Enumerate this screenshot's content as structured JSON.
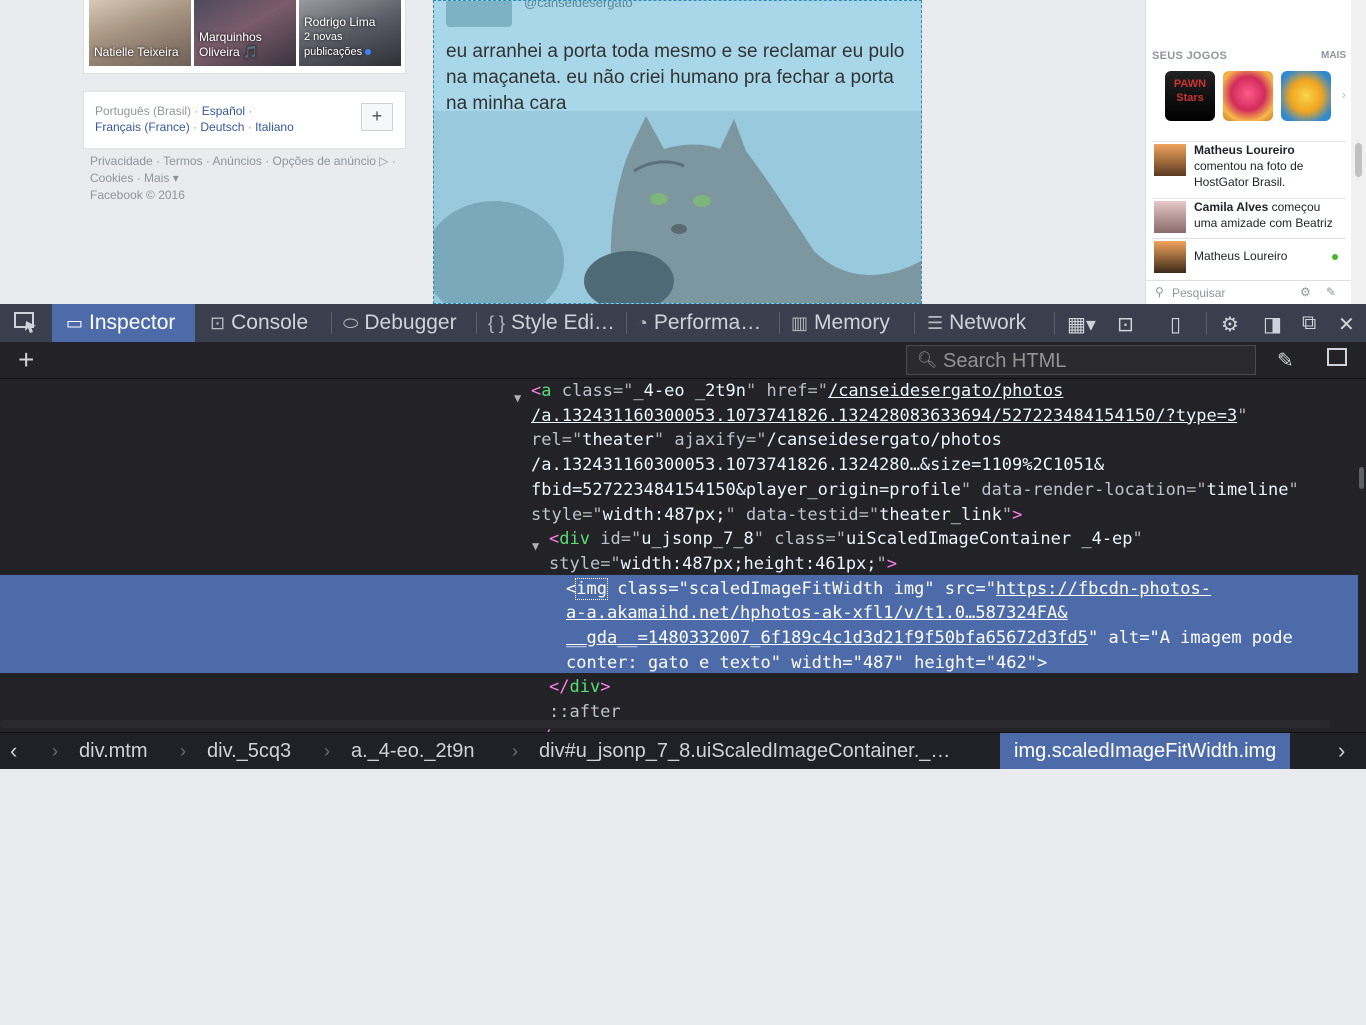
{
  "fb": {
    "friends": [
      {
        "name": "Natielle Teixeira",
        "sub": ""
      },
      {
        "name": "Marquinhos Oliveira 🎵",
        "sub": ""
      },
      {
        "name": "Rodrigo Lima",
        "sub": "2 novas publicações"
      }
    ],
    "languages": {
      "current": "Português (Brasil)",
      "links": [
        "Español",
        "Français (France)",
        "Deutsch",
        "Italiano"
      ],
      "add_label": "+"
    },
    "footer": {
      "line1": "Privacidade · Termos · Anúncios · Opções de anúncio ▷ ·",
      "line2": "Cookies · Mais ▾",
      "line3": "Facebook © 2016"
    },
    "post": {
      "handle": "@canseidesergato",
      "caption": "eu arranhei a porta toda mesmo e se reclamar eu pulo na maçaneta. eu não criei humano pra fechar a porta na minha cara"
    },
    "right": {
      "games_title": "SEUS JOGOS",
      "games_more": "MAIS",
      "games": [
        {
          "name": "Pawn Stars",
          "label": "PAWN Stars"
        },
        {
          "name": "Candy Crush",
          "label": ""
        },
        {
          "name": "Dragon game",
          "label": ""
        }
      ],
      "ticker": [
        {
          "name": "Matheus Loureiro",
          "text": "comentou na foto de HostGator Brasil."
        },
        {
          "name": "Camila Alves",
          "text": "começou uma amizade com Beatriz"
        }
      ],
      "chat_contact": "Matheus Loureiro",
      "chat_search_placeholder": "Pesquisar"
    }
  },
  "devtools": {
    "tabs": [
      {
        "label": "Inspector",
        "icon": "inspector-icon"
      },
      {
        "label": "Console",
        "icon": "console-icon"
      },
      {
        "label": "Debugger",
        "icon": "debugger-icon"
      },
      {
        "label": "Style Edi…",
        "icon": "style-editor-icon"
      },
      {
        "label": "Performa…",
        "icon": "performance-icon"
      },
      {
        "label": "Memory",
        "icon": "memory-icon"
      },
      {
        "label": "Network",
        "icon": "network-icon"
      }
    ],
    "search_placeholder": "Search HTML",
    "markup": {
      "a_tag": "a",
      "a_class_attr": "class",
      "a_class_val": "_4-eo _2t9n",
      "href_attr": "href",
      "href_val_1": "/canseidesergato/photos",
      "href_val_2": "/a.132431160300053.1073741826.132428083633694/527223484154150/?type=3",
      "rel_attr": "rel",
      "rel_val": "theater",
      "ajaxify_attr": "ajaxify",
      "ajaxify_val_1": "/canseidesergato/photos",
      "ajaxify_val_2": "/a.132431160300053.1073741826.1324280…&size=1109%2C1051&",
      "ajaxify_val_3": "fbid=527223484154150&player_origin=profile",
      "render_attr": "data-render-location",
      "render_val": "timeline",
      "style_attr": "style",
      "a_style_val": "width:487px;",
      "testid_attr": "data-testid",
      "testid_val": "theater_link",
      "div_tag": "div",
      "div_id_attr": "id",
      "div_id_val": "u_jsonp_7_8",
      "div_class_attr": "class",
      "div_class_val": "uiScaledImageContainer _4-ep",
      "div_style_val": "width:487px;height:461px;",
      "img_tag": "img",
      "img_class_attr": "class",
      "img_class_val": "scaledImageFitWidth img",
      "src_attr": "src",
      "src_val_1": "https://fbcdn-photos-",
      "src_val_2": "a-a.akamaihd.net/hphotos-ak-xfl1/v/t1.0…587324FA&",
      "src_val_3": "__gda__=1480332007_6f189c4c1d3d21f9f50bfa65672d3fd5",
      "alt_attr": "alt",
      "alt_val_1": "A imagem pode",
      "alt_val_2": "conter: gato e texto",
      "width_attr": "width",
      "width_val": "487",
      "height_attr": "height",
      "height_val": "462",
      "close_div": "div",
      "after": "::after",
      "partial_close": "</a>"
    },
    "breadcrumbs": [
      "div.mtm",
      "div._5cq3",
      "a._4-eo._2t9n",
      "div#u_jsonp_7_8.uiScaledImageContainer._…",
      "img.scaledImageFitWidth.img"
    ]
  }
}
